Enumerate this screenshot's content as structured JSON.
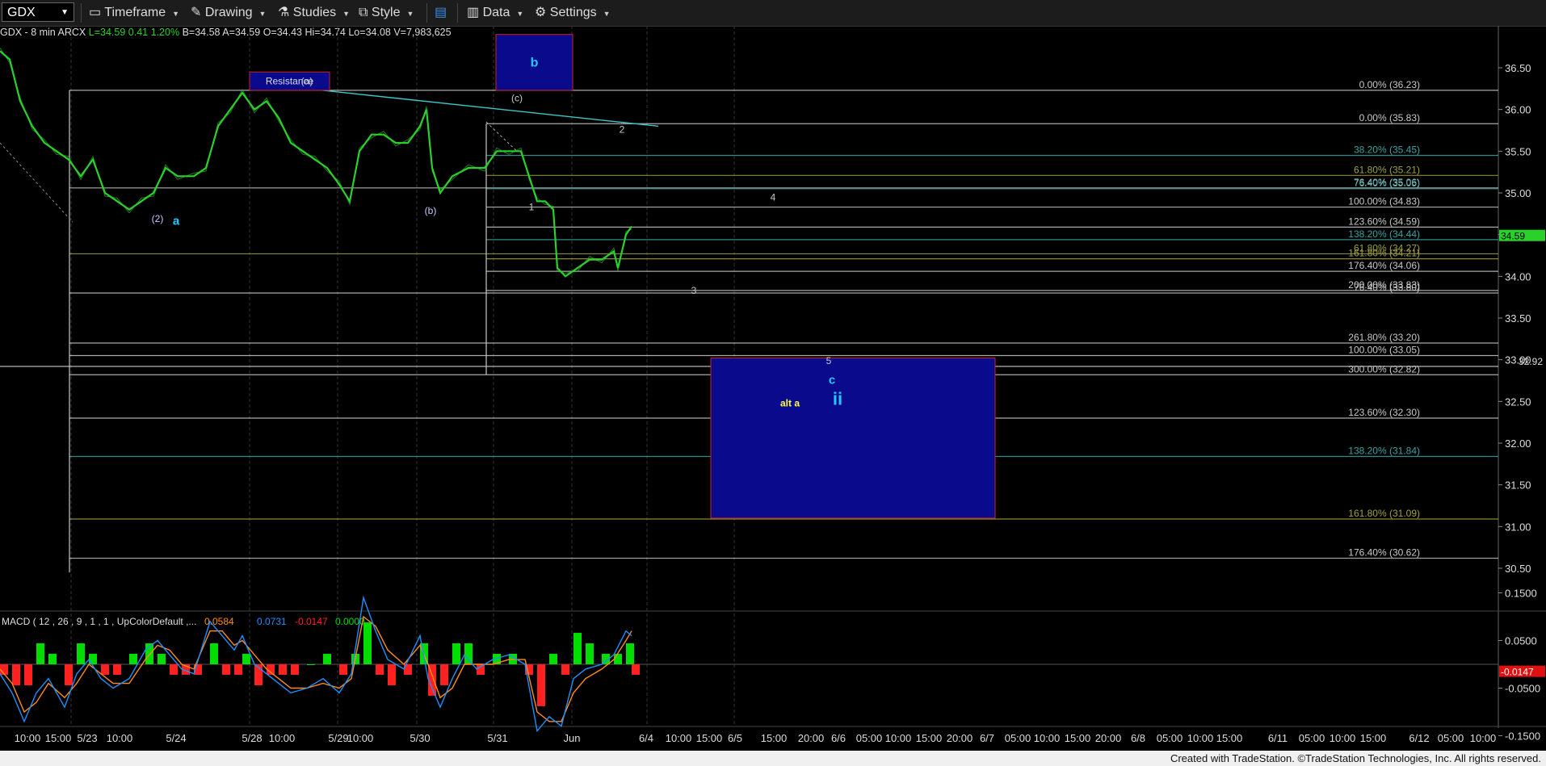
{
  "toolbar": {
    "symbol": "GDX",
    "timeframe": "Timeframe",
    "drawing": "Drawing",
    "studies": "Studies",
    "style": "Style",
    "data": "Data",
    "settings": "Settings"
  },
  "header": {
    "symbol_info": "GDX - 8 min  ARCX",
    "last": "L=34.59",
    "change": "0.41",
    "pct": "1.20%",
    "bid": "B=34.58",
    "ask": "A=34.59",
    "open": "O=34.43",
    "hi": "Hi=34.74",
    "lo": "Lo=34.08",
    "vol": "V=7,983,625"
  },
  "colors": {
    "price": "#2bd12b",
    "up": "#00dd00",
    "down": "#ff2020",
    "fib_white": "#c8c8c8",
    "box": "#0a0a8c",
    "macd": "#1e8fff",
    "signal": "#ff8c1a"
  },
  "chart_data": {
    "type": "line",
    "y_axis": {
      "ylim": [
        30.0,
        36.8
      ],
      "ticks": [
        "36.50",
        "36.00",
        "35.50",
        "35.00",
        "34.50",
        "34.00",
        "33.50",
        "33.00",
        "32.50",
        "32.00",
        "31.50",
        "31.00",
        "30.50"
      ]
    },
    "last_price_tag": "34.59",
    "price_tag_2": "32.92",
    "x_ticks": [
      "10:00",
      "15:00",
      "5/23",
      "10:00",
      "5/24",
      "5/28",
      "10:00",
      "5/29",
      "10:00",
      "5/30",
      "5/31",
      "Jun",
      "6/4",
      "10:00",
      "15:00",
      "6/5",
      "15:00",
      "20:00",
      "6/6",
      "05:00",
      "10:00",
      "15:00",
      "20:00",
      "6/7",
      "05:00",
      "10:00",
      "15:00",
      "20:00",
      "6/8",
      "05:00",
      "10:00",
      "15:00",
      "6/11",
      "05:00",
      "10:00",
      "15:00",
      "6/12",
      "05:00",
      "10:00"
    ],
    "price_points": [
      [
        0,
        36.7
      ],
      [
        12,
        36.6
      ],
      [
        25,
        36.1
      ],
      [
        40,
        35.8
      ],
      [
        55,
        35.6
      ],
      [
        70,
        35.5
      ],
      [
        85,
        35.4
      ],
      [
        100,
        35.2
      ],
      [
        115,
        35.4
      ],
      [
        130,
        35.0
      ],
      [
        145,
        34.9
      ],
      [
        160,
        34.8
      ],
      [
        175,
        34.9
      ],
      [
        190,
        35.0
      ],
      [
        205,
        35.3
      ],
      [
        220,
        35.2
      ],
      [
        240,
        35.2
      ],
      [
        255,
        35.3
      ],
      [
        270,
        35.8
      ],
      [
        285,
        36.0
      ],
      [
        300,
        36.2
      ],
      [
        315,
        36.0
      ],
      [
        330,
        36.1
      ],
      [
        345,
        35.9
      ],
      [
        360,
        35.6
      ],
      [
        375,
        35.5
      ],
      [
        390,
        35.4
      ],
      [
        405,
        35.3
      ],
      [
        420,
        35.1
      ],
      [
        433,
        34.9
      ],
      [
        445,
        35.5
      ],
      [
        460,
        35.7
      ],
      [
        475,
        35.7
      ],
      [
        490,
        35.6
      ],
      [
        505,
        35.6
      ],
      [
        520,
        35.8
      ],
      [
        528,
        36.0
      ],
      [
        535,
        35.3
      ],
      [
        545,
        35.0
      ],
      [
        560,
        35.2
      ],
      [
        580,
        35.3
      ],
      [
        600,
        35.3
      ],
      [
        615,
        35.5
      ],
      [
        630,
        35.5
      ],
      [
        645,
        35.5
      ],
      [
        655,
        35.2
      ],
      [
        665,
        34.9
      ],
      [
        675,
        34.9
      ],
      [
        685,
        34.8
      ],
      [
        690,
        34.1
      ],
      [
        700,
        34.0
      ],
      [
        715,
        34.1
      ],
      [
        730,
        34.2
      ],
      [
        745,
        34.2
      ],
      [
        760,
        34.3
      ],
      [
        765,
        34.1
      ],
      [
        775,
        34.5
      ],
      [
        782,
        34.6
      ]
    ],
    "macd_label": "MACD ( 12 , 26 , 9 , 1 , 1 , UpColorDefault ,...",
    "macd_values": {
      "macd": "0.0584",
      "signal": "0.0731",
      "hist": "-0.0147",
      "zero": "0.0000"
    },
    "macd_axis": [
      "0.1500",
      "0.0500",
      "-0.0500",
      "-0.1500"
    ],
    "macd_tag": "-0.0147",
    "macd_series": [
      [
        0,
        -0.02
      ],
      [
        15,
        -0.06
      ],
      [
        30,
        -0.12
      ],
      [
        45,
        -0.06
      ],
      [
        60,
        -0.03
      ],
      [
        80,
        -0.09
      ],
      [
        95,
        -0.02
      ],
      [
        110,
        0.01
      ],
      [
        125,
        -0.03
      ],
      [
        140,
        -0.05
      ],
      [
        160,
        -0.03
      ],
      [
        180,
        0.03
      ],
      [
        195,
        0.05
      ],
      [
        210,
        0.02
      ],
      [
        225,
        -0.01
      ],
      [
        240,
        -0.02
      ],
      [
        260,
        0.09
      ],
      [
        275,
        0.06
      ],
      [
        290,
        0.03
      ],
      [
        300,
        0.06
      ],
      [
        315,
        0.0
      ],
      [
        330,
        -0.02
      ],
      [
        345,
        -0.04
      ],
      [
        360,
        -0.06
      ],
      [
        380,
        -0.05
      ],
      [
        400,
        -0.03
      ],
      [
        420,
        -0.06
      ],
      [
        435,
        -0.02
      ],
      [
        450,
        0.14
      ],
      [
        465,
        0.07
      ],
      [
        480,
        0.01
      ],
      [
        500,
        -0.01
      ],
      [
        520,
        0.06
      ],
      [
        530,
        -0.03
      ],
      [
        545,
        -0.09
      ],
      [
        560,
        -0.03
      ],
      [
        575,
        0.02
      ],
      [
        590,
        -0.01
      ],
      [
        610,
        0.01
      ],
      [
        630,
        0.02
      ],
      [
        650,
        0.0
      ],
      [
        665,
        -0.14
      ],
      [
        680,
        -0.11
      ],
      [
        695,
        -0.13
      ],
      [
        710,
        -0.03
      ],
      [
        725,
        -0.01
      ],
      [
        745,
        0.0
      ],
      [
        760,
        0.02
      ],
      [
        775,
        0.07
      ],
      [
        782,
        0.06
      ]
    ],
    "signal_series": [
      [
        0,
        -0.01
      ],
      [
        15,
        -0.04
      ],
      [
        30,
        -0.1
      ],
      [
        45,
        -0.08
      ],
      [
        60,
        -0.04
      ],
      [
        80,
        -0.07
      ],
      [
        95,
        -0.04
      ],
      [
        110,
        0.0
      ],
      [
        125,
        -0.02
      ],
      [
        140,
        -0.04
      ],
      [
        160,
        -0.04
      ],
      [
        180,
        0.01
      ],
      [
        195,
        0.04
      ],
      [
        210,
        0.03
      ],
      [
        225,
        0.0
      ],
      [
        240,
        -0.01
      ],
      [
        260,
        0.07
      ],
      [
        275,
        0.07
      ],
      [
        290,
        0.04
      ],
      [
        300,
        0.05
      ],
      [
        315,
        0.02
      ],
      [
        330,
        -0.01
      ],
      [
        345,
        -0.03
      ],
      [
        360,
        -0.05
      ],
      [
        380,
        -0.05
      ],
      [
        400,
        -0.04
      ],
      [
        420,
        -0.05
      ],
      [
        435,
        -0.03
      ],
      [
        450,
        0.1
      ],
      [
        465,
        0.08
      ],
      [
        480,
        0.03
      ],
      [
        500,
        0.0
      ],
      [
        520,
        0.04
      ],
      [
        530,
        0.0
      ],
      [
        545,
        -0.07
      ],
      [
        560,
        -0.05
      ],
      [
        575,
        0.0
      ],
      [
        590,
        0.0
      ],
      [
        610,
        0.0
      ],
      [
        630,
        0.01
      ],
      [
        650,
        0.01
      ],
      [
        665,
        -0.1
      ],
      [
        680,
        -0.12
      ],
      [
        695,
        -0.12
      ],
      [
        710,
        -0.06
      ],
      [
        725,
        -0.03
      ],
      [
        745,
        -0.01
      ],
      [
        760,
        0.01
      ],
      [
        775,
        0.05
      ],
      [
        782,
        0.07
      ]
    ],
    "fib_labels": [
      {
        "text": "0.00% (36.23)",
        "price": 36.23,
        "color": "#c8c8c8"
      },
      {
        "text": "0.00% (35.83)",
        "price": 35.83,
        "color": "#c8c8c8"
      },
      {
        "text": "38.20% (35.45)",
        "price": 35.45,
        "color": "#3aa3a3"
      },
      {
        "text": "61.80% (35.21)",
        "price": 35.21,
        "color": "#a0a040"
      },
      {
        "text": "76.40% (35.06)",
        "price": 35.06,
        "color": "#c8c8c8"
      },
      {
        "text": "76.40% (35.05)",
        "price": 35.05,
        "color": "#3aa3a3"
      },
      {
        "text": "100.00% (34.83)",
        "price": 34.83,
        "color": "#c8c8c8"
      },
      {
        "text": "123.60% (34.59)",
        "price": 34.59,
        "color": "#c8c8c8"
      },
      {
        "text": "138.20% (34.44)",
        "price": 34.44,
        "color": "#3aa3a3"
      },
      {
        "text": "61.80% (34.27)",
        "price": 34.27,
        "color": "#a0a040"
      },
      {
        "text": "161.80% (34.21)",
        "price": 34.21,
        "color": "#a0a040"
      },
      {
        "text": "176.40% (34.06)",
        "price": 34.06,
        "color": "#c8c8c8"
      },
      {
        "text": "200.00% (33.83)",
        "price": 33.83,
        "color": "#c8c8c8"
      },
      {
        "text": "76.40% (33.80)",
        "price": 33.8,
        "color": "#c8c8c8"
      },
      {
        "text": "261.80% (33.20)",
        "price": 33.2,
        "color": "#c8c8c8"
      },
      {
        "text": "100.00% (33.05)",
        "price": 33.05,
        "color": "#c8c8c8"
      },
      {
        "text": "300.00% (32.82)",
        "price": 32.82,
        "color": "#c8c8c8"
      },
      {
        "text": "123.60% (32.30)",
        "price": 32.3,
        "color": "#c8c8c8"
      },
      {
        "text": "138.20% (31.84)",
        "price": 31.84,
        "color": "#3aa3a3"
      },
      {
        "text": "161.80% (31.09)",
        "price": 31.09,
        "color": "#a0a040"
      },
      {
        "text": "176.40% (30.62)",
        "price": 30.62,
        "color": "#c8c8c8"
      }
    ],
    "annotations": [
      {
        "text": "(2)",
        "x": 195,
        "price": 34.65,
        "color": "#c8c8ff"
      },
      {
        "text": "a",
        "x": 218,
        "price": 34.62,
        "color": "#22c8ff"
      },
      {
        "text": "(a)",
        "x": 380,
        "price": 36.3,
        "color": "#c8c8c8"
      },
      {
        "text": "(b)",
        "x": 533,
        "price": 34.75,
        "color": "#c8c8ff"
      },
      {
        "text": "(c)",
        "x": 640,
        "price": 36.1,
        "color": "#c8c8c8"
      },
      {
        "text": "1",
        "x": 658,
        "price": 34.79,
        "color": "#c8c8c8"
      },
      {
        "text": "2",
        "x": 770,
        "price": 35.72,
        "color": "#c8c8c8"
      },
      {
        "text": "3",
        "x": 859,
        "price": 33.79,
        "color": "#c8c8c8"
      },
      {
        "text": "4",
        "x": 957,
        "price": 34.91,
        "color": "#c8c8c8"
      },
      {
        "text": "5",
        "x": 1026,
        "price": 32.95,
        "color": "#c8c8c8"
      },
      {
        "text": "c",
        "x": 1030,
        "price": 32.71,
        "color": "#22c8ff"
      },
      {
        "text": "ii",
        "x": 1037,
        "price": 32.46,
        "color": "#22c8ff"
      },
      {
        "text": "alt a",
        "x": 978,
        "price": 32.44,
        "color": "#ffff40"
      }
    ],
    "boxes": [
      {
        "label": "Resistance",
        "x1": 309,
        "x2": 408,
        "p_top": 36.45,
        "p_bot": 36.23
      },
      {
        "label": "b",
        "x1": 614,
        "x2": 709,
        "p_top": 36.9,
        "p_bot": 36.23
      },
      {
        "label": "",
        "x1": 880,
        "x2": 1232,
        "p_top": 33.02,
        "p_bot": 31.1
      }
    ]
  },
  "footer": "Created with TradeStation. ©TradeStation Technologies, Inc. All rights reserved."
}
